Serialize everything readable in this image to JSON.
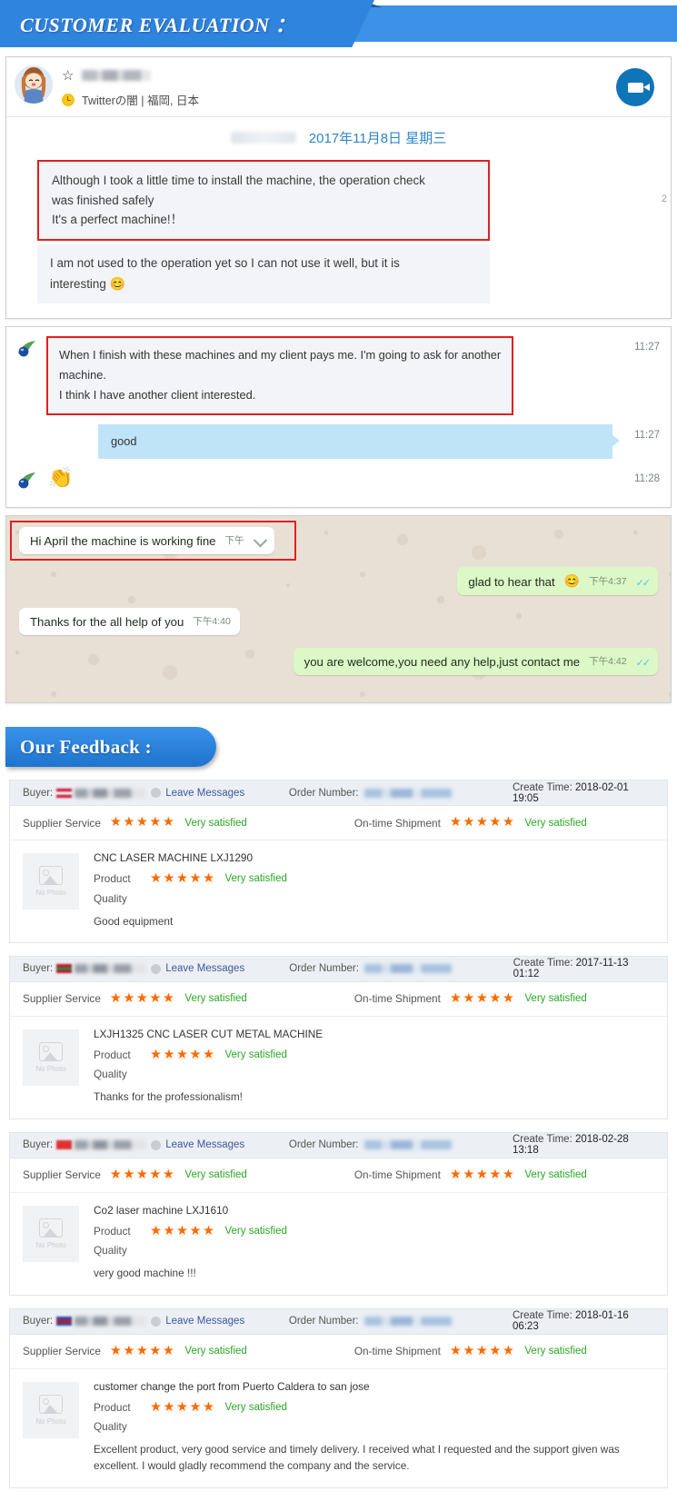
{
  "header": {
    "title": "CUSTOMER EVALUATION ："
  },
  "chat_social": {
    "avatar_name": "cartoon-girl-avatar",
    "star_icon": "☆",
    "handle_blurred": true,
    "meta": "Twitterの闇 | 福岡, 日本",
    "video_button": "video-call-icon",
    "date": "2017年11月8日 星期三",
    "edge_number": "2",
    "messages": [
      {
        "text_line1": "Although I took a little time to install the machine, the operation check",
        "text_line2": "was finished safely",
        "text_line3": "It's a perfect machine!！",
        "highlighted": true
      },
      {
        "text_line1": "I am not used to the operation yet so I can not use it well, but it is",
        "text_line2": "interesting",
        "emoji": "😊",
        "highlighted": false
      }
    ]
  },
  "chat_trade": {
    "messages": [
      {
        "side": "left",
        "line1": "When I finish with these machines and my client pays me. I'm going to ask for another",
        "line2": "machine.",
        "line3": "I think I have another client interested.",
        "time": "11:27",
        "highlighted": true
      },
      {
        "side": "right",
        "line1": "good",
        "time": "11:27",
        "highlighted": false
      },
      {
        "side": "left",
        "emoji": "👏",
        "time": "11:28",
        "highlighted": false
      }
    ]
  },
  "chat_whatsapp": {
    "messages": [
      {
        "side": "in",
        "text": "Hi April the machine is working fine",
        "time": "下午",
        "menu_icon": "chevron-down-icon",
        "highlighted": true
      },
      {
        "side": "out",
        "text": "glad to hear that",
        "emoji": "😊",
        "time": "下午4:37",
        "ticks": "✓✓"
      },
      {
        "side": "in",
        "text": "Thanks for the all help of you",
        "time": "下午4:40"
      },
      {
        "side": "out",
        "text": "you are welcome,you need any help,just contact me",
        "time": "下午4:42",
        "ticks": "✓✓"
      }
    ]
  },
  "feedback_header": {
    "title": "Our Feedback :"
  },
  "labels": {
    "buyer": "Buyer:",
    "leave_messages": "Leave Messages",
    "order_number": "Order Number:",
    "create_time": "Create Time:",
    "supplier_service": "Supplier Service",
    "on_time_shipment": "On-time Shipment",
    "product": "Product",
    "quality": "Quality",
    "no_photo": "No Photo",
    "stars": "★★★★★"
  },
  "feedback_cards": [
    {
      "create_time": "2018-02-01 19:05",
      "supplier_service_rating": "Very satisfied",
      "on_time_shipment_rating": "Very satisfied",
      "product_name": "CNC LASER MACHINE LXJ1290",
      "product_rating": "Very satisfied",
      "comment": "Good equipment"
    },
    {
      "create_time": "2017-11-13 01:12",
      "supplier_service_rating": "Very satisfied",
      "on_time_shipment_rating": "Very satisfied",
      "product_name": "LXJH1325 CNC LASER CUT METAL MACHINE",
      "product_rating": "Very satisfied",
      "comment": "Thanks for the professionalism!"
    },
    {
      "create_time": "2018-02-28 13:18",
      "supplier_service_rating": "Very satisfied",
      "on_time_shipment_rating": "Very satisfied",
      "product_name": "Co2 laser machine LXJ1610",
      "product_rating": "Very satisfied",
      "comment": "very good machine !!!"
    },
    {
      "create_time": "2018-01-16 06:23",
      "supplier_service_rating": "Very satisfied",
      "on_time_shipment_rating": "Very satisfied",
      "product_name": "customer change the port from Puerto Caldera to san jose",
      "product_rating": "Very satisfied",
      "comment": "Excellent product, very good service and timely delivery. I received what I requested and the support given was excellent. I would gladly recommend the company and the service."
    }
  ],
  "colors": {
    "brand_blue": "#2f84de",
    "star_orange": "#ff6a00",
    "rating_green": "#2aa823",
    "highlight_red": "#e02020",
    "whatsapp_out": "#dcf8c6",
    "trade_blue_bubble": "#bfe4f8"
  }
}
